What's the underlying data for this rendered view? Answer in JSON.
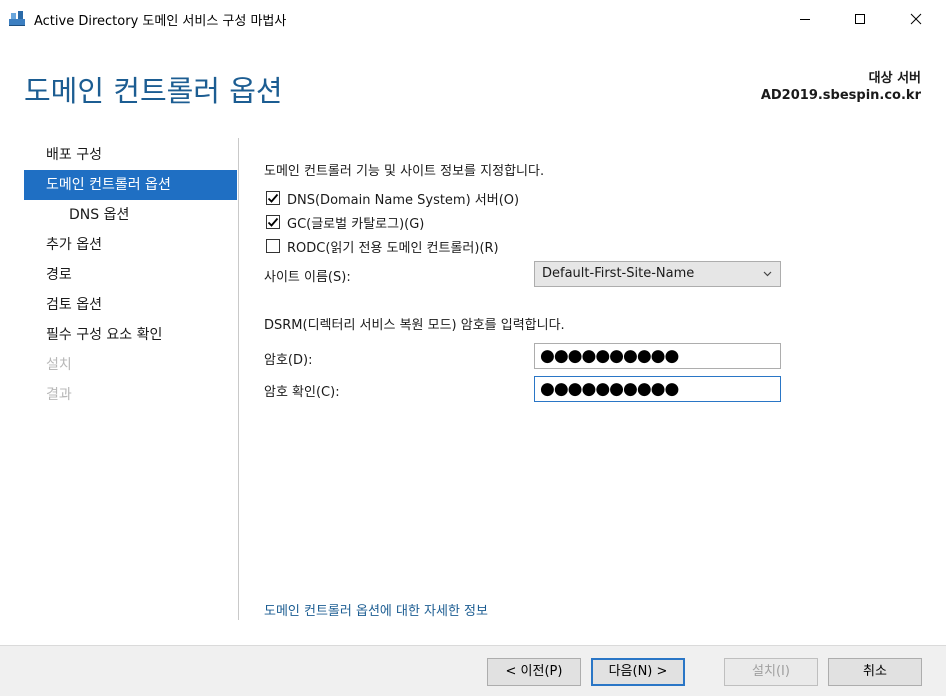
{
  "window": {
    "title": "Active Directory 도메인 서비스 구성 마법사"
  },
  "header": {
    "page_title": "도메인 컨트롤러 옵션",
    "target_label": "대상 서버",
    "target_server": "AD2019.sbespin.co.kr"
  },
  "nav": {
    "items": [
      {
        "label": "배포 구성",
        "state": "normal"
      },
      {
        "label": "도메인 컨트롤러 옵션",
        "state": "active"
      },
      {
        "label": "DNS 옵션",
        "state": "sub"
      },
      {
        "label": "추가 옵션",
        "state": "normal"
      },
      {
        "label": "경로",
        "state": "normal"
      },
      {
        "label": "검토 옵션",
        "state": "normal"
      },
      {
        "label": "필수 구성 요소 확인",
        "state": "normal"
      },
      {
        "label": "설치",
        "state": "disabled"
      },
      {
        "label": "결과",
        "state": "disabled"
      }
    ]
  },
  "main": {
    "intro": "도메인 컨트롤러 기능 및 사이트 정보를 지정합니다.",
    "checkboxes": [
      {
        "label": "DNS(Domain Name System) 서버(O)",
        "checked": true
      },
      {
        "label": "GC(글로벌 카탈로그)(G)",
        "checked": true
      },
      {
        "label": "RODC(읽기 전용 도메인 컨트롤러)(R)",
        "checked": false
      }
    ],
    "site_label": "사이트 이름(S):",
    "site_value": "Default-First-Site-Name",
    "dsrm_text": "DSRM(디렉터리 서비스 복원 모드) 암호를 입력합니다.",
    "password_label": "암호(D):",
    "password_value": "●●●●●●●●●●",
    "confirm_label": "암호 확인(C):",
    "confirm_value": "●●●●●●●●●●",
    "info_link": "도메인 컨트롤러 옵션에 대한 자세한 정보"
  },
  "footer": {
    "prev_label": "< 이전(P)",
    "next_label": "다음(N) >",
    "install_label": "설치(I)",
    "cancel_label": "취소"
  },
  "colors": {
    "accent": "#1f6fc3",
    "title_blue": "#1c5d92"
  }
}
